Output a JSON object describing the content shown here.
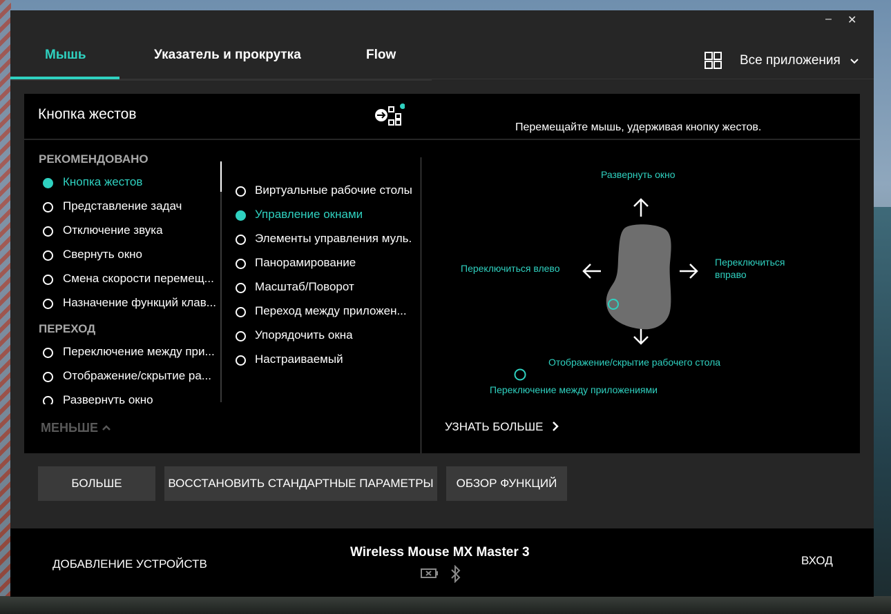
{
  "window": {
    "minimize_glyph": "–",
    "close_glyph": "✕"
  },
  "tabs": [
    {
      "label": "Мышь",
      "active": true
    },
    {
      "label": "Указатель и прокрутка"
    },
    {
      "label": "Flow"
    }
  ],
  "apps_selector": {
    "label": "Все приложения",
    "icon": "grid-icon",
    "chevron": "chevron-down-icon"
  },
  "panel": {
    "title": "Кнопка жестов",
    "hint": "Перемещайте мышь, удерживая кнопку жестов.",
    "sections": {
      "recommended": "РЕКОМЕНДОВАНО",
      "transition": "ПЕРЕХОД"
    },
    "recommended_items": [
      {
        "label": "Кнопка жестов",
        "selected": true
      },
      {
        "label": "Представление задач"
      },
      {
        "label": "Отключение звука"
      },
      {
        "label": "Свернуть окно"
      },
      {
        "label": "Смена скорости перемещ..."
      },
      {
        "label": "Назначение функций клав..."
      }
    ],
    "transition_items": [
      {
        "label": "Переключение между при..."
      },
      {
        "label": "Отображение/скрытие ра..."
      },
      {
        "label": "Развернуть окно"
      }
    ],
    "middle_items": [
      {
        "label": "Виртуальные рабочие столы"
      },
      {
        "label": "Управление окнами",
        "selected": true
      },
      {
        "label": "Элементы управления муль..."
      },
      {
        "label": "Панорамирование"
      },
      {
        "label": "Масштаб/Поворот"
      },
      {
        "label": "Переход между приложен..."
      },
      {
        "label": "Упорядочить окна"
      },
      {
        "label": "Настраиваемый"
      }
    ],
    "less": "МЕНЬШЕ",
    "gestures": {
      "up": "Развернуть окно",
      "left": "Переключиться влево",
      "right_line1": "Переключиться",
      "right_line2": "вправо",
      "down": "Отображение/скрытие рабочего стола",
      "click": "Переключение между приложениями"
    },
    "learn_more": "УЗНАТЬ БОЛЬШЕ"
  },
  "buttons": {
    "more": "БОЛЬШЕ",
    "restore": "ВОССТАНОВИТЬ СТАНДАРТНЫЕ ПАРАМЕТРЫ",
    "overview": "ОБЗОР ФУНКЦИЙ"
  },
  "footer": {
    "add_devices": "ДОБАВЛЕНИЕ УСТРОЙСТВ",
    "device_name": "Wireless Mouse MX Master 3",
    "login": "ВХОД"
  },
  "colors": {
    "accent": "#2fd1c0",
    "window_bg": "#262626",
    "panel_bg": "#000000"
  }
}
